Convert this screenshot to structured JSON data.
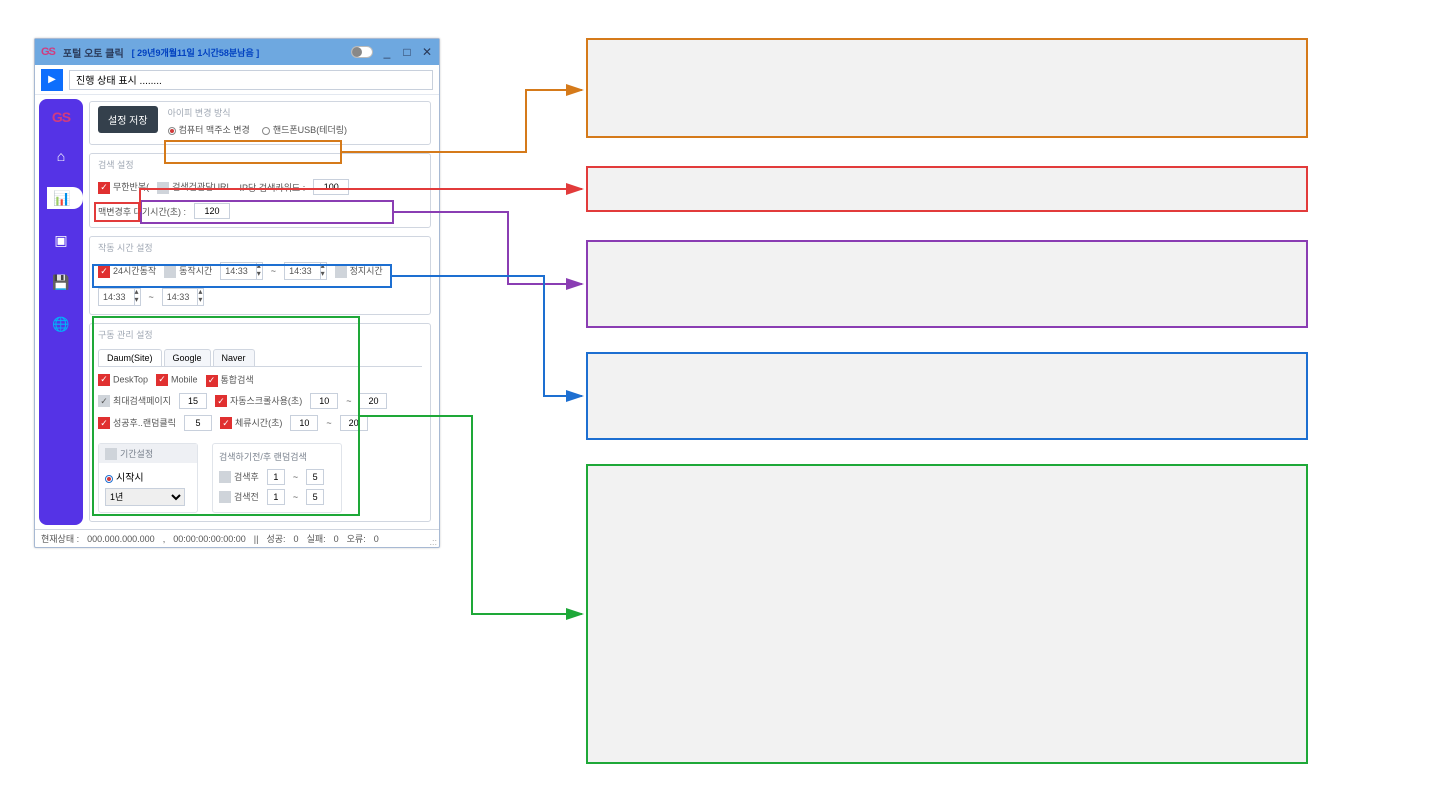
{
  "titlebar": {
    "logo": "GS",
    "title": "포털 오토 클릭",
    "countdown": "[  29년9개월11일 1시간58분남음  ]",
    "minimize": "_",
    "maximize": "□",
    "close": "✕"
  },
  "toolbar": {
    "play_glyph": "▶",
    "status_text": "진행 상태 표시 ........"
  },
  "sidebar": {
    "logo": "GS",
    "items": [
      {
        "name": "home-icon",
        "glyph": "⌂"
      },
      {
        "name": "chart-icon",
        "glyph": "📊"
      },
      {
        "name": "card-icon",
        "glyph": "▣"
      },
      {
        "name": "floppy-icon",
        "glyph": "💾"
      },
      {
        "name": "globe-icon",
        "glyph": "🌐"
      }
    ]
  },
  "panel_ip": {
    "title": "아이피 변경 방식",
    "save_btn": "설정 저장",
    "opt_pc": "컴퓨터 맥주소 변경",
    "opt_usb": "핸드폰USB(테더링)"
  },
  "panel_search": {
    "title": "검색 설정",
    "infinite": "무한반복(",
    "url_label": "검색건관담URL",
    "kw_label": "IP당 검색카워드 :",
    "kw_value": "100",
    "mac_label": "맥변경후 대기시간(초) :",
    "mac_value": "120"
  },
  "panel_time": {
    "title": "작동 시간 설정",
    "run24": "24시간동작",
    "start_lbl": "동작시간",
    "stop_lbl": "정지시간",
    "t1": "14:33",
    "t2": "14:33",
    "t3": "14:33",
    "t4": "14:33",
    "tilde": "~"
  },
  "panel_drive": {
    "title": "구동 관리 설정",
    "tabs": [
      "Daum(Site)",
      "Google",
      "Naver"
    ],
    "row1": {
      "desktop": "DeskTop",
      "mobile": "Mobile",
      "unified": "통합검색"
    },
    "row2": {
      "maxpages": "최대검색페이지",
      "maxpages_v": "15",
      "autoscroll": "자동스크롤사용(초)",
      "as1": "10",
      "tilde": "~",
      "as2": "20"
    },
    "row3": {
      "success": "성공후..랜덤클릭",
      "success_v": "5",
      "stay": "체류시간(초)",
      "st1": "10",
      "st2": "20"
    },
    "period": {
      "title": "기간설정",
      "start": "시작시",
      "select": "1년"
    },
    "around": {
      "title": "검색하기전/후 랜덤검색",
      "after": "검색후",
      "a1": "1",
      "a2": "5",
      "before": "검색전",
      "b1": "1",
      "b2": "5"
    }
  },
  "statusbar": {
    "ip_label": "현재상태 :",
    "ip": "000.000.000.000",
    "time": "00:00:00:00:00:00",
    "sep": "||",
    "ok": "성공:",
    "ok_v": "0",
    "fail": "실패:",
    "fail_v": "0",
    "err": "오류:",
    "err_v": "0",
    "resize": ".::"
  },
  "callouts": {
    "orange": "",
    "red": "",
    "purple": "",
    "blue": "",
    "green": ""
  }
}
